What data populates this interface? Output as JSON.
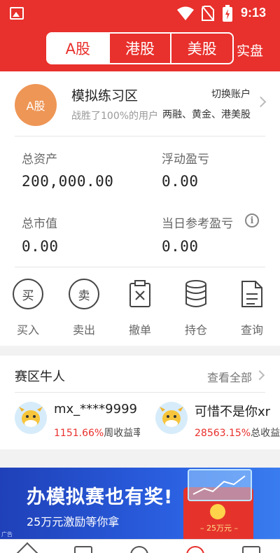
{
  "status_bar": {
    "time": "9:13"
  },
  "header": {
    "tabs": [
      {
        "label": "A股",
        "active": true
      },
      {
        "label": "港股",
        "active": false
      },
      {
        "label": "美股",
        "active": false
      }
    ],
    "real_trade": "实盘"
  },
  "account": {
    "avatar_text": "A股",
    "title": "模拟练习区",
    "subtitle": "战胜了100%的用户",
    "switch_label": "切换账户",
    "markets": "两融、黄金、港美股"
  },
  "stats": {
    "total_assets_label": "总资产",
    "total_assets_value": "200,000.00",
    "floating_pl_label": "浮动盈亏",
    "floating_pl_value": "0.00",
    "market_value_label": "总市值",
    "market_value_value": "0.00",
    "daily_pl_label": "当日参考盈亏",
    "daily_pl_value": "0.00"
  },
  "actions": [
    {
      "glyph": "买",
      "label": "买入"
    },
    {
      "glyph": "卖",
      "label": "卖出"
    },
    {
      "label": "撤单"
    },
    {
      "label": "持仓"
    },
    {
      "label": "查询"
    }
  ],
  "top_players": {
    "title": "赛区牛人",
    "view_all": "查看全部",
    "players": [
      {
        "name": "mx_****9999",
        "gain": "1151.66%",
        "gain_label": "周收益率"
      },
      {
        "name": "可惜不是你xr",
        "gain": "28563.15%",
        "gain_label": "总收益率"
      }
    ]
  },
  "banner": {
    "headline": "办模拟赛也有奖!",
    "subtext": "25万元激励等你拿",
    "envelope_label": "– 25万元 –",
    "ad_tag": "广告"
  },
  "colors": {
    "brand_red": "#e8302c",
    "avatar_orange": "#ee9656",
    "banner_blue": "#2a5fe0"
  }
}
